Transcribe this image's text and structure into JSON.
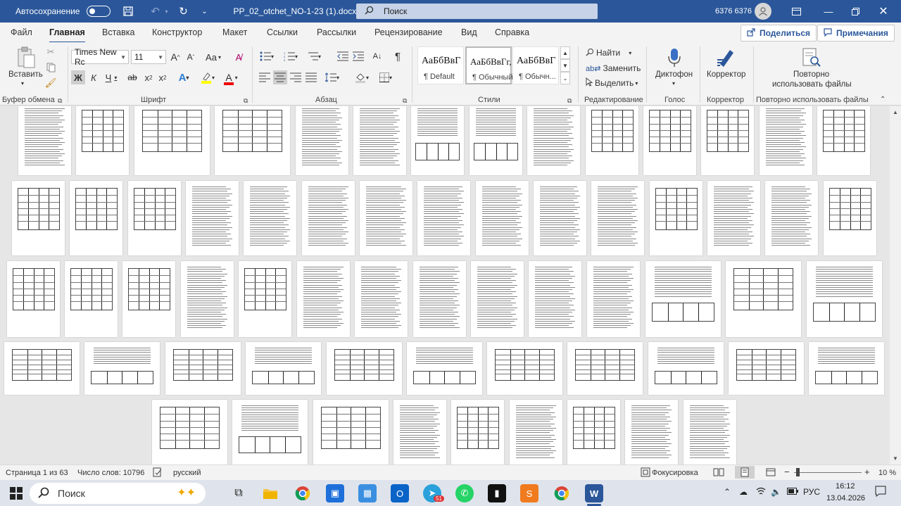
{
  "titlebar": {
    "autosave_label": "Автосохранение",
    "doc_title": "PP_02_otchet_NO-1-23 (1).docx  -  Word",
    "search_label": "Поиск",
    "user_name": "6376 6376"
  },
  "tabs": [
    {
      "label": "Файл"
    },
    {
      "label": "Главная"
    },
    {
      "label": "Вставка"
    },
    {
      "label": "Конструктор"
    },
    {
      "label": "Макет"
    },
    {
      "label": "Ссылки"
    },
    {
      "label": "Рассылки"
    },
    {
      "label": "Рецензирование"
    },
    {
      "label": "Вид"
    },
    {
      "label": "Справка"
    }
  ],
  "share_label": "Поделиться",
  "comments_label": "Примечания",
  "ribbon": {
    "paste_label": "Вставить",
    "groups": {
      "clipboard": "Буфер обмена",
      "font": "Шрифт",
      "paragraph": "Абзац",
      "styles": "Стили",
      "editing": "Редактирование",
      "voice": "Голос",
      "editor": "Корректор",
      "reuse": "Повторно использовать файлы"
    },
    "font_name": "Times New Rc",
    "font_size": "11",
    "font_grow": "A",
    "font_shrink": "A",
    "change_case": "Aa",
    "bold": "Ж",
    "italic": "К",
    "underline": "Ч",
    "strike": "ab",
    "subscript": "x",
    "superscript": "x",
    "styles": [
      {
        "sample": "АаБбВвГ",
        "name": "¶ Default"
      },
      {
        "sample": "АаБбВвГг,",
        "name": "¶ Обычный"
      },
      {
        "sample": "АаБбВвГ",
        "name": "¶ Обычн..."
      }
    ],
    "find_label": "Найти",
    "replace_label": "Заменить",
    "select_label": "Выделить",
    "dictate_label": "Диктофон",
    "editor_label": "Корректор",
    "reuse_label_1": "Повторно",
    "reuse_label_2": "использовать файлы"
  },
  "status": {
    "page": "Страница 1 из 63",
    "words": "Число слов: 10796",
    "language": "русский",
    "focus": "Фокусировка",
    "zoom": "10 %"
  },
  "taskbar": {
    "search_label": "Поиск",
    "telegram_badge": "51",
    "lang": "РУС",
    "time": "16:12",
    "date": "13.04.2026"
  },
  "colors": {
    "titlebar": "#2b579a",
    "accent": "#2b579a"
  }
}
